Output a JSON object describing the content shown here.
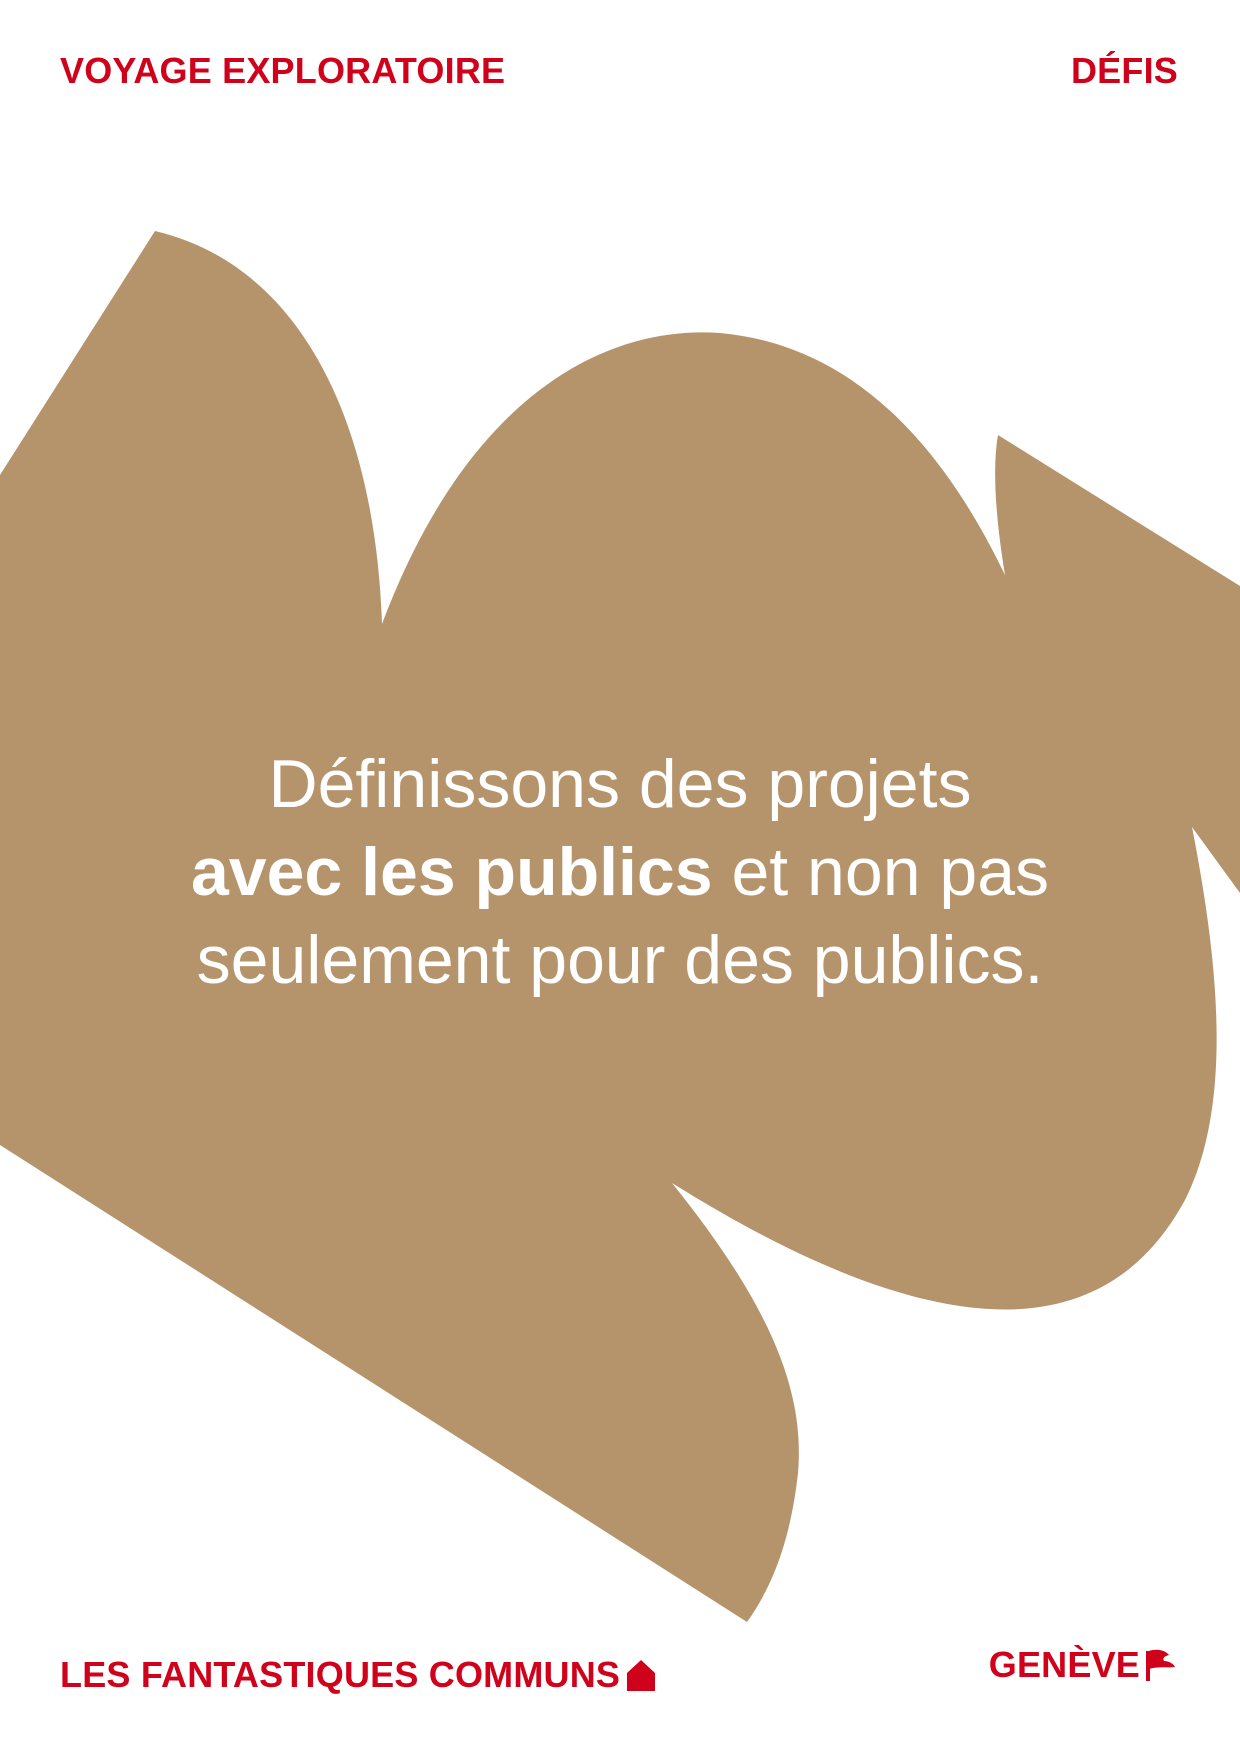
{
  "header": {
    "left": "VOYAGE EXPLORATOIRE",
    "right": "DÉFIS"
  },
  "statement": {
    "line1": "Définissons des projets",
    "line2_bold": "avec les publics",
    "line2_rest": " et non pas",
    "line3": "seulement pour des publics."
  },
  "footer": {
    "left": "LES FANTASTIQUES COMMUNS",
    "right": "GENÈVE"
  },
  "icons": {
    "house": "house-icon",
    "flag": "flag-icon"
  },
  "colors": {
    "accent": "#d0021b",
    "shape": "#b5946c",
    "background": "#ffffff",
    "statement_text": "#ffffff"
  }
}
